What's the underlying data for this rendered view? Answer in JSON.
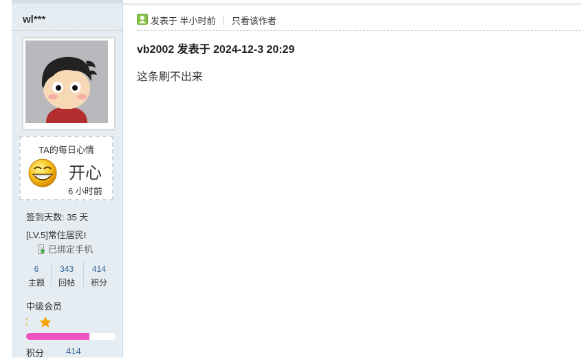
{
  "sidebar": {
    "username": "wl***",
    "mood": {
      "title": "TA的每日心情",
      "name": "开心",
      "time": "6 小时前",
      "face_icon": "grin-face-icon"
    },
    "signin": "签到天数: 35 天",
    "level": "[LV.5]常住居民I",
    "phone": "已绑定手机",
    "counts": [
      {
        "num": "6",
        "label": "主题"
      },
      {
        "num": "343",
        "label": "回帖"
      },
      {
        "num": "414",
        "label": "积分"
      }
    ],
    "group": "中级会员",
    "progress_fraction": 0.71,
    "progress_color": "#ee53c1",
    "points_label": "积分",
    "points_value": "414"
  },
  "post": {
    "meta_posted": "发表于 半小时前",
    "meta_only_author": "只看该作者",
    "meta_separator": "|",
    "quote_header": "vb2002 发表于 2024-12-3 20:29",
    "body": "这条刷不出来"
  }
}
